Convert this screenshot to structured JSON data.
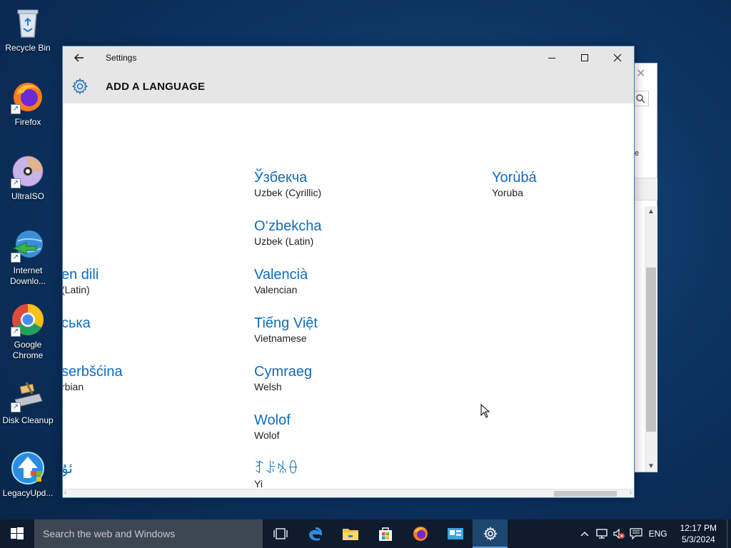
{
  "desktop": {
    "icons": [
      {
        "label": "Recycle Bin"
      },
      {
        "label": "Firefox"
      },
      {
        "label": "UltraISO"
      },
      {
        "label": "Internet Downlo..."
      },
      {
        "label": "Google Chrome"
      },
      {
        "label": "Disk Cleanup"
      },
      {
        "label": "LegacyUpd..."
      }
    ]
  },
  "settings": {
    "title": "Settings",
    "heading": "ADD A LANGUAGE",
    "languages": [
      {
        "native": "en dili",
        "english": "(Latin)"
      },
      {
        "native": "ська",
        "english": ""
      },
      {
        "native": "serbšćina",
        "english": "rbian"
      },
      {
        "native": "ئۇ",
        "english": ""
      },
      {
        "native": "Ўзбекча",
        "english": "Uzbek (Cyrillic)"
      },
      {
        "native": "O‘zbekcha",
        "english": "Uzbek (Latin)"
      },
      {
        "native": "Valencià",
        "english": "Valencian"
      },
      {
        "native": "Tiếng Việt",
        "english": "Vietnamese"
      },
      {
        "native": "Cymraeg",
        "english": "Welsh"
      },
      {
        "native": "Wolof",
        "english": "Wolof"
      },
      {
        "native": "ꆈꌠꁱꂷ",
        "english": "Yi"
      },
      {
        "native": "Yorùbá",
        "english": "Yoruba"
      }
    ]
  },
  "taskbar": {
    "search_placeholder": "Search the web and Windows",
    "language": "ENG",
    "time": "12:17 PM",
    "date": "5/3/2024"
  }
}
